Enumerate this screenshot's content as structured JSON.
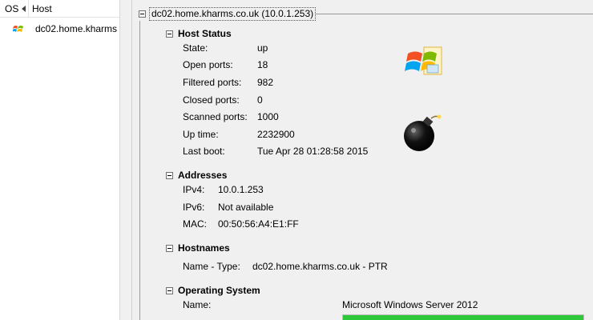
{
  "list": {
    "col_os": "OS",
    "col_host": "Host",
    "hosts": [
      {
        "name": "dc02.home.kharms"
      }
    ]
  },
  "detail": {
    "title": "dc02.home.kharms.co.uk (10.0.1.253)",
    "host_status": {
      "heading": "Host Status",
      "rows": [
        {
          "label": "State:",
          "value": "up"
        },
        {
          "label": "Open ports:",
          "value": "18"
        },
        {
          "label": "Filtered ports:",
          "value": "982"
        },
        {
          "label": "Closed ports:",
          "value": "0"
        },
        {
          "label": "Scanned ports:",
          "value": "1000"
        },
        {
          "label": "Up time:",
          "value": "2232900"
        },
        {
          "label": "Last boot:",
          "value": "Tue Apr 28 01:28:58 2015"
        }
      ]
    },
    "addresses": {
      "heading": "Addresses",
      "rows": [
        {
          "label": "IPv4:",
          "value": "10.0.1.253"
        },
        {
          "label": "IPv6:",
          "value": "Not available"
        },
        {
          "label": "MAC:",
          "value": "00:50:56:A4:E1:FF"
        }
      ]
    },
    "hostnames": {
      "heading": "Hostnames",
      "rows": [
        {
          "label": "Name - Type:",
          "value": "dc02.home.kharms.co.uk - PTR"
        }
      ]
    },
    "operating_system": {
      "heading": "Operating System",
      "rows": [
        {
          "label": "Name:",
          "value": "Microsoft Windows Server 2012"
        }
      ],
      "accuracy_fraction": 1.0
    }
  }
}
